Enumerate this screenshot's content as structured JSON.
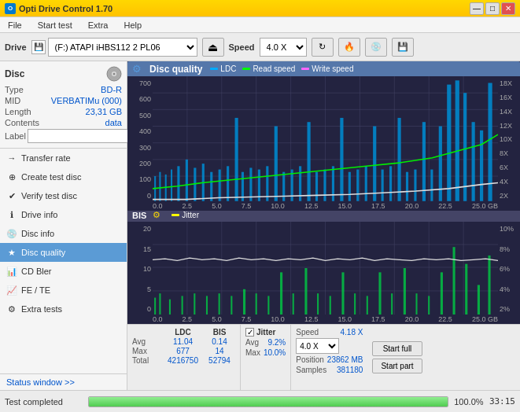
{
  "titleBar": {
    "title": "Opti Drive Control 1.70",
    "minBtn": "—",
    "maxBtn": "□",
    "closeBtn": "✕"
  },
  "menu": {
    "items": [
      "File",
      "Start test",
      "Extra",
      "Help"
    ]
  },
  "toolbar": {
    "driveLabel": "Drive",
    "driveValue": "(F:) ATAPI iHBS112  2 PL06",
    "speedLabel": "Speed",
    "speedValue": "4.0 X"
  },
  "sidebar": {
    "discLabel": "Disc",
    "discFields": [
      {
        "label": "Type",
        "value": "BD-R"
      },
      {
        "label": "MID",
        "value": "VERBATIMu (000)"
      },
      {
        "label": "Length",
        "value": "23,31 GB"
      },
      {
        "label": "Contents",
        "value": "data"
      },
      {
        "label": "Label",
        "value": ""
      }
    ],
    "navItems": [
      {
        "label": "Transfer rate",
        "icon": "→"
      },
      {
        "label": "Create test disc",
        "icon": "⊕"
      },
      {
        "label": "Verify test disc",
        "icon": "✔"
      },
      {
        "label": "Drive info",
        "icon": "ℹ"
      },
      {
        "label": "Disc info",
        "icon": "💿"
      },
      {
        "label": "Disc quality",
        "icon": "★",
        "active": true
      },
      {
        "label": "CD Bler",
        "icon": "📊"
      },
      {
        "label": "FE / TE",
        "icon": "📈"
      },
      {
        "label": "Extra tests",
        "icon": "⚙"
      }
    ],
    "statusWindowBtn": "Status window >>"
  },
  "chart": {
    "title": "Disc quality",
    "legends": [
      {
        "label": "LDC",
        "color": "#00aaff"
      },
      {
        "label": "Read speed",
        "color": "#00ff00"
      },
      {
        "label": "Write speed",
        "color": "#ff66ff"
      }
    ],
    "topChart": {
      "yLabels": [
        "700",
        "600",
        "500",
        "400",
        "300",
        "200",
        "100",
        "0"
      ],
      "yLabelsRight": [
        "18X",
        "16X",
        "14X",
        "12X",
        "10X",
        "8X",
        "6X",
        "4X",
        "2X"
      ],
      "xLabels": [
        "0.0",
        "2.5",
        "5.0",
        "7.5",
        "10.0",
        "12.5",
        "15.0",
        "17.5",
        "20.0",
        "22.5",
        "25.0 GB"
      ]
    },
    "bottomChart": {
      "title": "BIS",
      "legends": [
        {
          "label": "Jitter",
          "color": "#ffff00"
        }
      ],
      "yLabels": [
        "20",
        "15",
        "10",
        "5",
        "0"
      ],
      "yLabelsRight": [
        "10%",
        "8%",
        "6%",
        "4%",
        "2%"
      ],
      "xLabels": [
        "0.0",
        "2.5",
        "5.0",
        "7.5",
        "10.0",
        "12.5",
        "15.0",
        "17.5",
        "20.0",
        "22.5",
        "25.0 GB"
      ]
    }
  },
  "stats": {
    "headers": [
      "LDC",
      "BIS",
      "",
      "Jitter",
      "Speed",
      ""
    ],
    "rows": [
      {
        "label": "Avg",
        "ldc": "11.04",
        "bis": "0.14",
        "jitter": "9.2%",
        "speed": "4.18 X"
      },
      {
        "label": "Max",
        "ldc": "677",
        "bis": "14",
        "jitter": "10.0%",
        "position": "23862 MB"
      },
      {
        "label": "Total",
        "ldc": "4216750",
        "bis": "52794",
        "samples": "381180"
      }
    ],
    "speedSelectValue": "4.0 X",
    "startFull": "Start full",
    "startPart": "Start part",
    "positionLabel": "Position",
    "samplesLabel": "Samples"
  },
  "bottomBar": {
    "statusText": "Test completed",
    "progressPercent": "100.0%",
    "timeDisplay": "33:15"
  }
}
